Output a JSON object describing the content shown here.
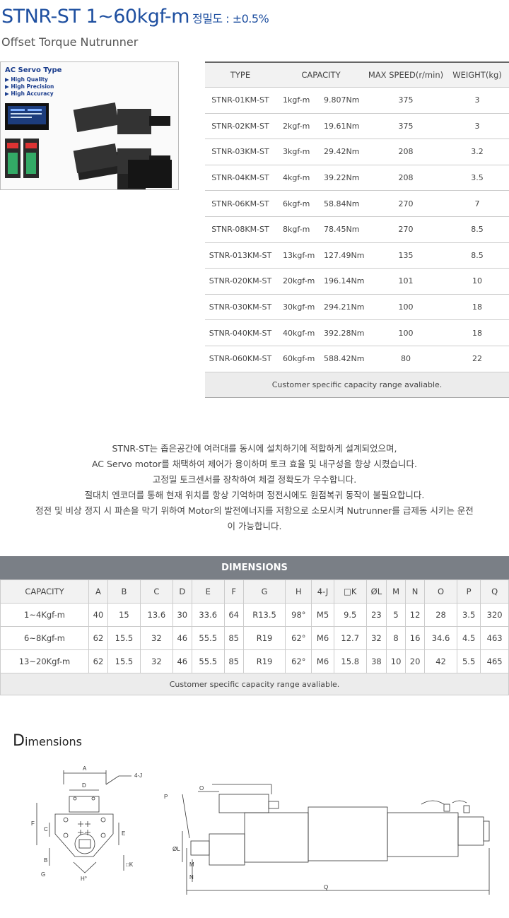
{
  "header": {
    "title": "STNR-ST 1~60kgf-m",
    "precision": "정밀도 : ±0.5%",
    "subtitle": "Offset Torque Nutrunner"
  },
  "product_image": {
    "heading": "AC Servo Type",
    "features": [
      "High Quality",
      "High Precision",
      "High Accuracy"
    ]
  },
  "spec_table": {
    "headers": [
      "TYPE",
      "CAPACITY",
      "MAX SPEED(r/min)",
      "WEIGHT(kg)"
    ],
    "rows": [
      {
        "type": "STNR-01KM-ST",
        "kgf": "1kgf-m",
        "nm": "9.807Nm",
        "speed": "375",
        "weight": "3"
      },
      {
        "type": "STNR-02KM-ST",
        "kgf": "2kgf-m",
        "nm": "19.61Nm",
        "speed": "375",
        "weight": "3"
      },
      {
        "type": "STNR-03KM-ST",
        "kgf": "3kgf-m",
        "nm": "29.42Nm",
        "speed": "208",
        "weight": "3.2"
      },
      {
        "type": "STNR-04KM-ST",
        "kgf": "4kgf-m",
        "nm": "39.22Nm",
        "speed": "208",
        "weight": "3.5"
      },
      {
        "type": "STNR-06KM-ST",
        "kgf": "6kgf-m",
        "nm": "58.84Nm",
        "speed": "270",
        "weight": "7"
      },
      {
        "type": "STNR-08KM-ST",
        "kgf": "8kgf-m",
        "nm": "78.45Nm",
        "speed": "270",
        "weight": "8.5"
      },
      {
        "type": "STNR-013KM-ST",
        "kgf": "13kgf-m",
        "nm": "127.49Nm",
        "speed": "135",
        "weight": "8.5"
      },
      {
        "type": "STNR-020KM-ST",
        "kgf": "20kgf-m",
        "nm": "196.14Nm",
        "speed": "101",
        "weight": "10"
      },
      {
        "type": "STNR-030KM-ST",
        "kgf": "30kgf-m",
        "nm": "294.21Nm",
        "speed": "100",
        "weight": "18"
      },
      {
        "type": "STNR-040KM-ST",
        "kgf": "40kgf-m",
        "nm": "392.28Nm",
        "speed": "100",
        "weight": "18"
      },
      {
        "type": "STNR-060KM-ST",
        "kgf": "60kgf-m",
        "nm": "588.42Nm",
        "speed": "80",
        "weight": "22"
      }
    ],
    "note": "Customer specific capacity range avaliable."
  },
  "description": [
    "STNR-ST는 좁은공간에 여러대를 동시에 설치하기에 적합하게 설계되었으며,",
    "AC Servo motor를 채택하여 제어가 용이하며 토크 효율 및 내구성을 향상 시켰습니다.",
    "고정밀 토크센서를 장착하여 체결 정확도가 우수합니다.",
    "절대치 엔코더를 통해 현재 위치를 항상 기억하며 정전시에도 원점복귀 동작이 불필요합니다.",
    "정전 및 비상 정지 시 파손을 막기 위하여 Motor의 발전에너지를 저항으로 소모시켜 Nutrunner를 급제동 시키는 운전",
    "이 가능합니다."
  ],
  "dimensions_table": {
    "title": "DIMENSIONS",
    "headers": [
      "CAPACITY",
      "A",
      "B",
      "C",
      "D",
      "E",
      "F",
      "G",
      "H",
      "4-J",
      "□K",
      "ØL",
      "M",
      "N",
      "O",
      "P",
      "Q"
    ],
    "rows": [
      [
        "1~4Kgf-m",
        "40",
        "15",
        "13.6",
        "30",
        "33.6",
        "64",
        "R13.5",
        "98°",
        "M5",
        "9.5",
        "23",
        "5",
        "12",
        "28",
        "3.5",
        "320"
      ],
      [
        "6~8Kgf-m",
        "62",
        "15.5",
        "32",
        "46",
        "55.5",
        "85",
        "R19",
        "62°",
        "M6",
        "12.7",
        "32",
        "8",
        "16",
        "34.6",
        "4.5",
        "463"
      ],
      [
        "13~20Kgf-m",
        "62",
        "15.5",
        "32",
        "46",
        "55.5",
        "85",
        "R19",
        "62°",
        "M6",
        "15.8",
        "38",
        "10",
        "20",
        "42",
        "5.5",
        "465"
      ]
    ],
    "note": "Customer specific capacity range avaliable."
  },
  "drawing": {
    "heading_initial": "D",
    "heading_rest": "imensions",
    "labels": {
      "A": "A",
      "D": "D",
      "J": "4-J",
      "F": "F",
      "C": "C",
      "E": "E",
      "B": "B",
      "G": "G",
      "K": "□K",
      "H": "H°",
      "P": "P",
      "O": "O",
      "L": "ØL",
      "M": "M",
      "N": "N",
      "Q": "Q"
    }
  }
}
